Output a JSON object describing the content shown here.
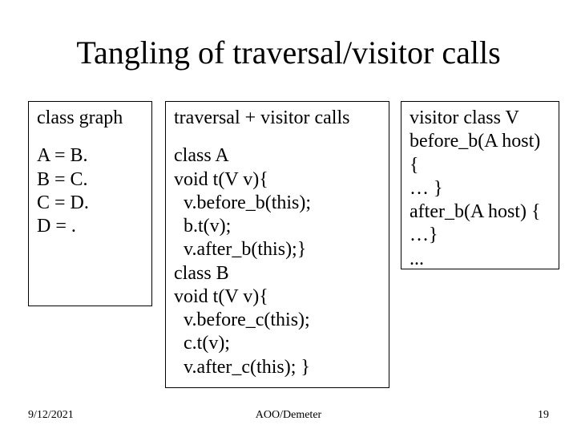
{
  "title": "Tangling of traversal/visitor calls",
  "left": {
    "header": "class graph",
    "lines": [
      "A = B.",
      "B = C.",
      "C = D.",
      "D = ."
    ]
  },
  "mid": {
    "header": "traversal + visitor calls",
    "lines": [
      "class A",
      "void t(V v){",
      "  v.before_b(this);",
      "  b.t(v);",
      "  v.after_b(this);}",
      "class B",
      "void t(V v){",
      "  v.before_c(this);",
      "  c.t(v);",
      "  v.after_c(this); }"
    ]
  },
  "right": {
    "lines": [
      "visitor class V",
      "before_b(A host) {",
      "   … }",
      "after_b(A host) {",
      "   …}",
      "..."
    ]
  },
  "footer": {
    "date": "9/12/2021",
    "center": "AOO/Demeter",
    "page": "19"
  }
}
